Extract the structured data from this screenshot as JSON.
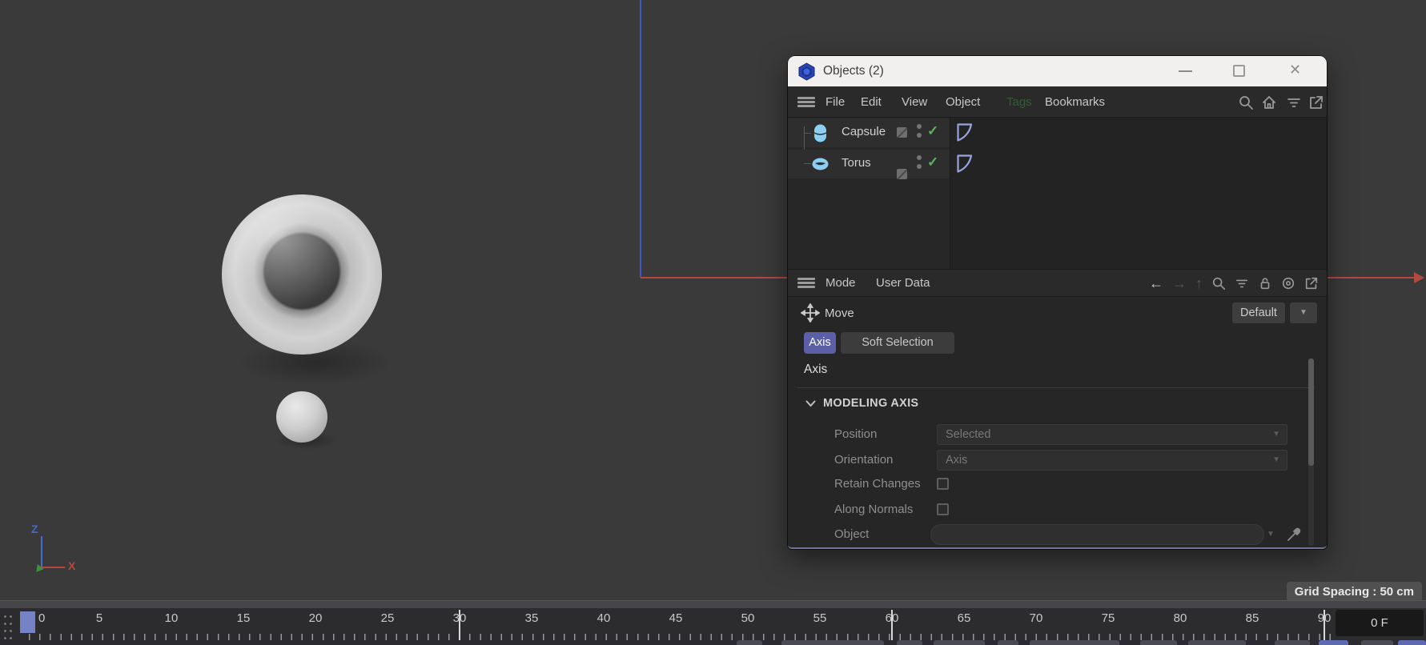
{
  "window": {
    "title": "Objects (2)",
    "menu": {
      "items": [
        "File",
        "Edit",
        "View",
        "Object",
        "Tags",
        "Bookmarks"
      ]
    },
    "object_list": {
      "items": [
        {
          "name": "Capsule",
          "icon": "capsule-icon",
          "enabled_check": "✓",
          "tag": "phong-tag"
        },
        {
          "name": "Torus",
          "icon": "torus-icon",
          "enabled_check": "✓",
          "tag": "phong-tag"
        }
      ]
    },
    "attributes": {
      "menu": [
        "Mode",
        "User Data"
      ],
      "tool": "Move",
      "preset": "Default",
      "tabs": [
        "Axis",
        "Soft Selection"
      ],
      "active_tab": "Axis",
      "section": "Axis",
      "group": "MODELING AXIS",
      "fields": {
        "position": {
          "label": "Position",
          "value": "Selected"
        },
        "orientation": {
          "label": "Orientation",
          "value": "Axis"
        },
        "retain_changes": {
          "label": "Retain Changes",
          "checked": false
        },
        "along_normals": {
          "label": "Along Normals",
          "checked": false
        },
        "object": {
          "label": "Object",
          "value": ""
        }
      }
    }
  },
  "viewport": {
    "grid_spacing_label": "Grid Spacing : 50 cm",
    "axis_gizmo": {
      "z": "Z",
      "x": "X"
    }
  },
  "timeline": {
    "frame_labels": [
      "0",
      "5",
      "10",
      "15",
      "20",
      "25",
      "30",
      "35",
      "40",
      "45",
      "50",
      "55",
      "60",
      "65",
      "70",
      "75",
      "80",
      "85",
      "90"
    ],
    "current_frame_label": "0 F"
  },
  "colors": {
    "accent_tab": "#5b5fa8",
    "object_icon_blue": "#8ccff2",
    "tag_blue": "#96a5e2",
    "check_green": "#59b559",
    "tags_menu_green": "#2f5e2f",
    "axis_x_red": "#b34a42",
    "axis_z_blue": "#3d56c6",
    "axis_y_green": "#3f8f3f",
    "playhead_blue": "#7583c6",
    "titlebar_bg": "#f1f0ee",
    "panel_bg": "#262626",
    "viewport_bg": "#3a3a3a"
  }
}
